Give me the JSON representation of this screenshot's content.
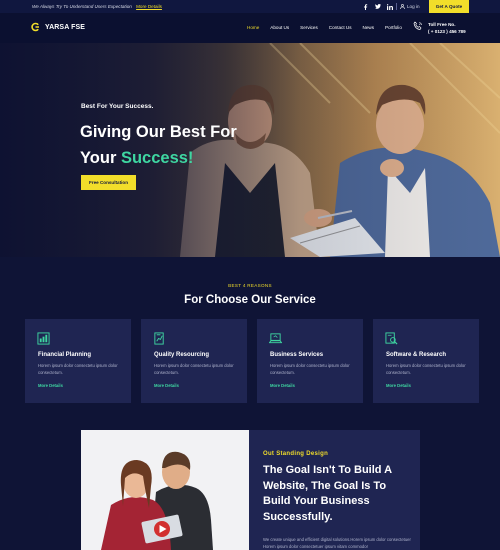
{
  "topbar": {
    "message": "We Always Try To Understand Users Expectation",
    "more_link": "More Details",
    "login": "Log in",
    "quote_button": "Get A Quote"
  },
  "header": {
    "brand": "YARSA FSE",
    "nav": [
      "Home",
      "About Us",
      "Services",
      "Contact Us",
      "News",
      "Portfolio"
    ],
    "active_nav": "Home",
    "tollfree_label": "Toll Free No.",
    "tollfree_number": "( + 0123 ) 456 789"
  },
  "hero": {
    "kicker": "Best For Your Success.",
    "title_line1": "Giving Our Best For",
    "title_line2_plain": "Your",
    "title_line2_accent": "Success!",
    "cta": "Free Consultation"
  },
  "services": {
    "kicker": "BEST 4 REASONS",
    "title": "For Choose Our Service",
    "cards": [
      {
        "icon": "bar-chart-icon",
        "title": "Financial Planning",
        "desc": "Horem ipsum dolor consectetu ipsum dolor consectetum.",
        "more": "More Details"
      },
      {
        "icon": "document-chart-icon",
        "title": "Quality Resourcing",
        "desc": "Horem ipsum dolor consectetu ipsum dolor consectetum.",
        "more": "More Details"
      },
      {
        "icon": "laptop-icon",
        "title": "Business Services",
        "desc": "Horem ipsum dolor consectetu ipsum dolor consectetum.",
        "more": "More Details"
      },
      {
        "icon": "research-icon",
        "title": "Software & Research",
        "desc": "Horem ipsum dolor consectetu ipsum dolor consectetum.",
        "more": "More Details"
      }
    ]
  },
  "about": {
    "kicker": "Out Standing Design",
    "title": "The Goal Isn't To Build A Website, The Goal Is To Build Your Business Successfully.",
    "desc": "We create unique and efficient digital solutions.Horem ipsum dolor consectetuer Horem ipsum dolor consectetuer ipsum vitam commodor"
  },
  "colors": {
    "accent_yellow": "#f2de2a",
    "accent_green": "#3ed6a1",
    "background": "#0f1436",
    "card": "#1f2552"
  }
}
